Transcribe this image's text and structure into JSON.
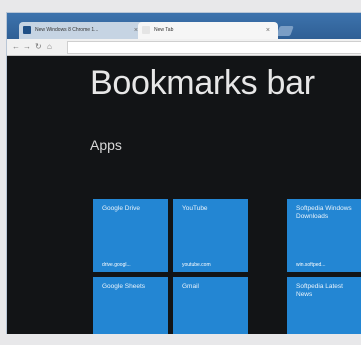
{
  "browser": {
    "tabs": [
      {
        "label": "New Windows 8 Chrome 1...",
        "close": "×"
      },
      {
        "label": "New Tab",
        "close": "×"
      }
    ],
    "nav": {
      "back": "←",
      "forward": "→",
      "reload": "↻",
      "home": "⌂"
    },
    "omnibox": {
      "value": ""
    }
  },
  "page": {
    "title": "Bookmarks bar",
    "section": "Apps",
    "tiles": [
      {
        "name": "Google Drive",
        "url": "drive.googl..."
      },
      {
        "name": "YouTube",
        "url": "youtube.com"
      },
      {
        "name": "Softpedia Windows Downloads",
        "url": "win.softped..."
      },
      {
        "name": "Google Sheets",
        "url": ""
      },
      {
        "name": "Gmail",
        "url": ""
      },
      {
        "name": "Softpedia Latest News",
        "url": ""
      }
    ]
  },
  "colors": {
    "tile": "#2386d3",
    "page_background": "#121416",
    "title_bar": "#2f5f95"
  },
  "icons": {
    "tab_favicon": "page-icon",
    "back": "back-arrow-icon",
    "forward": "forward-arrow-icon",
    "reload": "reload-icon",
    "home": "home-icon"
  }
}
